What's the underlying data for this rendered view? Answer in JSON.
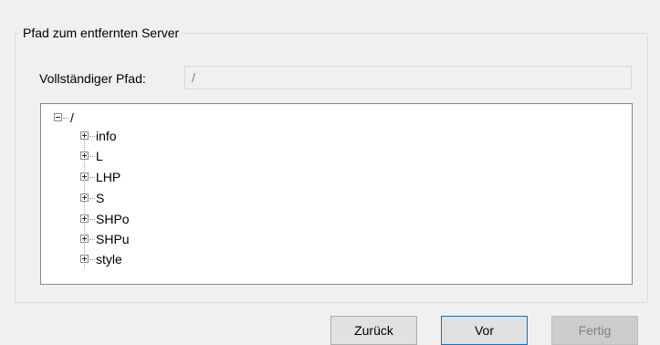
{
  "group": {
    "title": "Pfad zum entfernten Server"
  },
  "path": {
    "label": "Vollständiger Pfad:",
    "value": "/"
  },
  "tree": {
    "root": {
      "label": "/",
      "state": "expanded"
    },
    "children": [
      {
        "label": "info",
        "state": "collapsed"
      },
      {
        "label": "L",
        "state": "collapsed"
      },
      {
        "label": "LHP",
        "state": "collapsed"
      },
      {
        "label": "S",
        "state": "collapsed"
      },
      {
        "label": "SHPo",
        "state": "collapsed"
      },
      {
        "label": "SHPu",
        "state": "collapsed"
      },
      {
        "label": "style",
        "state": "collapsed"
      }
    ]
  },
  "buttons": {
    "back": "Zurück",
    "next": "Vor",
    "finish": "Fertig"
  },
  "colors": {
    "accent": "#0078d7",
    "background": "#f0f0f0",
    "disabled_text": "#838383"
  }
}
